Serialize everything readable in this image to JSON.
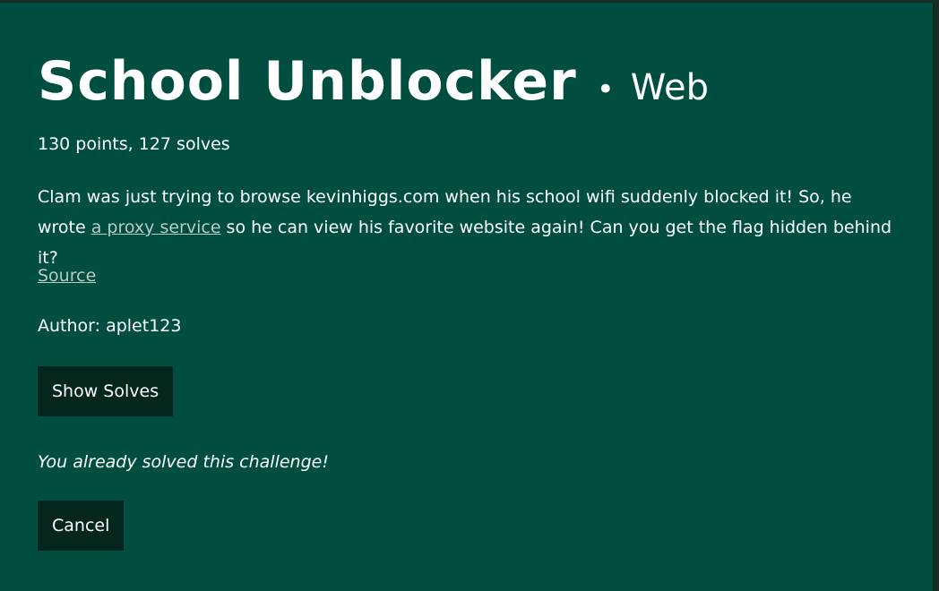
{
  "challenge": {
    "title": "School Unblocker",
    "separator": "•",
    "category": "Web",
    "points_solves": "130 points, 127 solves",
    "description_before": "Clam was just trying to browse kevinhiggs.com when his school wifi suddenly blocked it! So, he wrote ",
    "description_link": "a proxy service",
    "description_after": " so he can view his favorite website again! Can you get the flag hidden behind it?",
    "source_link": "Source",
    "author": "Author: aplet123",
    "show_solves_label": "Show Solves",
    "solved_message": "You already solved this challenge!",
    "cancel_label": "Cancel"
  },
  "colors": {
    "modal_bg": "#004e40",
    "button_bg": "#05261e",
    "link": "#b9c9c3",
    "text": "#ffffff"
  }
}
